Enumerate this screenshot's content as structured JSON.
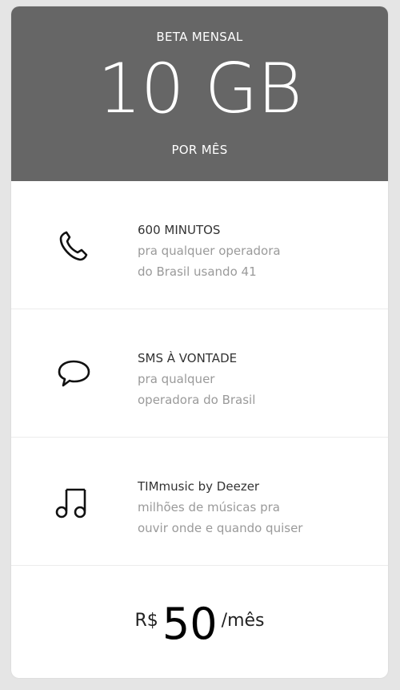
{
  "header": {
    "plan_name": "BETA MENSAL",
    "data_amount": "10 GB",
    "period": "POR MÊS",
    "bg_color": "#666666"
  },
  "features": [
    {
      "icon": "phone-icon",
      "title": "600 MINUTOS",
      "desc_line1": "pra qualquer operadora",
      "desc_line2": "do Brasil usando 41"
    },
    {
      "icon": "chat-bubble-icon",
      "title": "SMS À VONTADE",
      "desc_line1": "pra qualquer",
      "desc_line2": "operadora do Brasil"
    },
    {
      "icon": "music-note-icon",
      "title": "TIMmusic by Deezer",
      "desc_line1": "milhões de músicas pra",
      "desc_line2": "ouvir onde e quando quiser"
    }
  ],
  "price": {
    "currency": "R$",
    "amount": "50",
    "period": "/mês"
  }
}
